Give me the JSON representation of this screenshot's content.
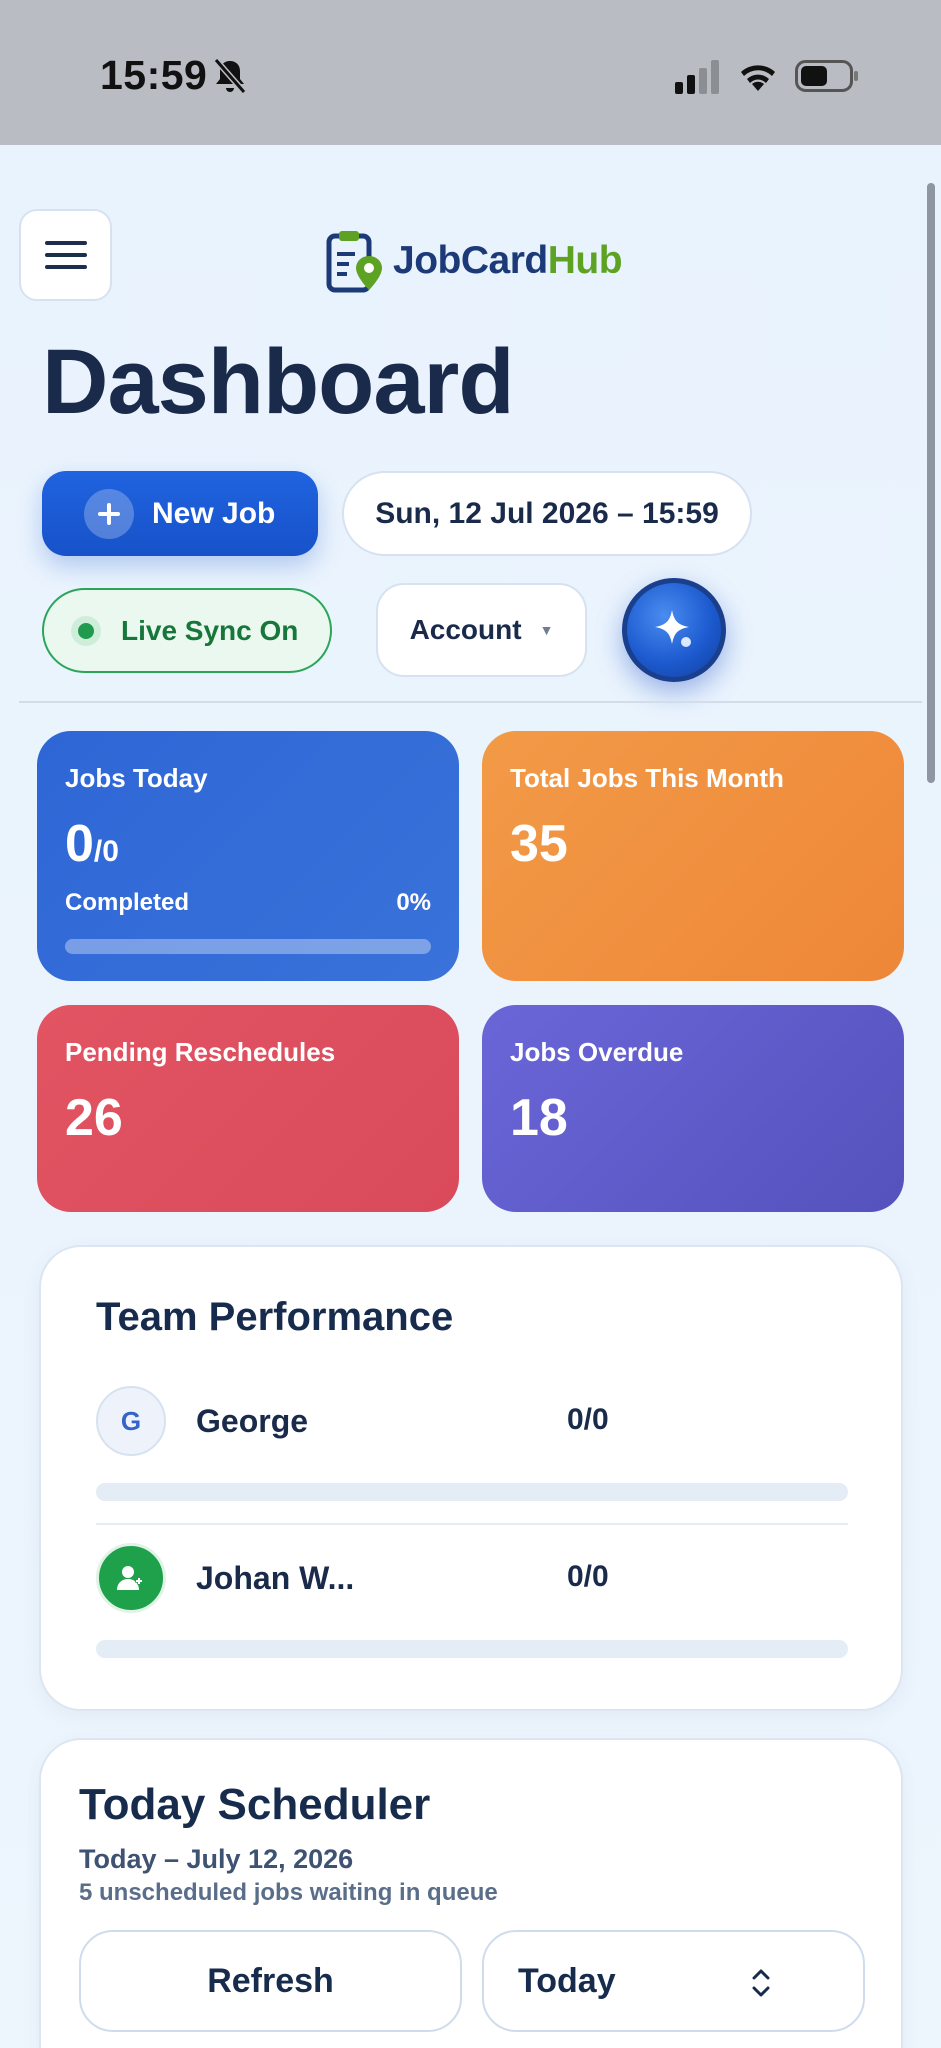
{
  "status_bar": {
    "time": "15:59"
  },
  "header": {
    "logo_part1": "JobCard",
    "logo_part2": "Hub",
    "page_title": "Dashboard"
  },
  "actions": {
    "new_job_label": "New Job",
    "datetime": "Sun, 12 Jul 2026 – 15:59",
    "live_sync_label": "Live Sync On",
    "account_label": "Account"
  },
  "stats": {
    "jobs_today": {
      "label": "Jobs Today",
      "value": "0",
      "total": "/0",
      "completed_label": "Completed",
      "completed_percent": "0%",
      "progress_fraction": 0
    },
    "total_month": {
      "label": "Total Jobs This Month",
      "value": "35"
    },
    "pending_reschedules": {
      "label": "Pending Reschedules",
      "value": "26"
    },
    "jobs_overdue": {
      "label": "Jobs Overdue",
      "value": "18"
    }
  },
  "team_performance": {
    "title": "Team Performance",
    "members": [
      {
        "initial": "G",
        "name": "George",
        "score": "0/0",
        "progress_fraction": 0
      },
      {
        "initial": "",
        "name": "Johan W...",
        "score": "0/0",
        "progress_fraction": 0
      }
    ]
  },
  "scheduler": {
    "title": "Today Scheduler",
    "date_line": "Today – July 12, 2026",
    "queue_line": "5 unscheduled jobs waiting in queue",
    "refresh_label": "Refresh",
    "range_selected": "Today"
  },
  "colors": {
    "primary": "#1f5fd8",
    "jobs_today_card": "#2e66d6",
    "total_month_card": "#f0913f",
    "pending_card": "#dd505f",
    "overdue_card": "#5f5ccc",
    "live_sync_green": "#1f9a4e",
    "logo_blue": "#1c3a78",
    "logo_green": "#5ea224"
  }
}
